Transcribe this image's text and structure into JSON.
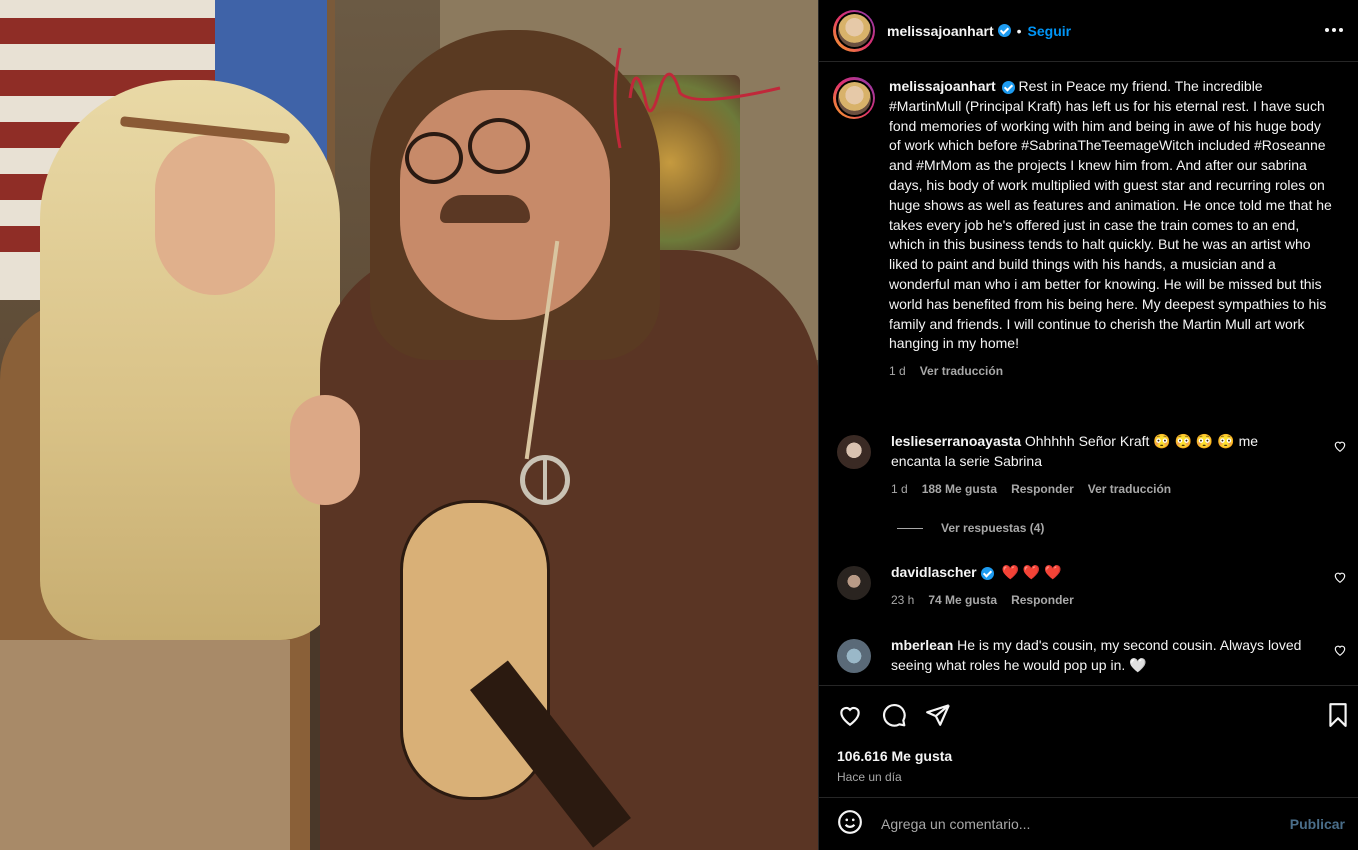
{
  "post": {
    "author": "melissajoanhart",
    "follow_label": "Seguir",
    "separator": "•",
    "caption": "Rest in Peace my friend. The incredible #MartinMull (Principal Kraft) has left us for his eternal rest. I have such fond memories of working with him and being in awe of his huge body of work which before #SabrinaTheTeemageWitch included #Roseanne and #MrMom as the projects I knew him from. And after our sabrina days, his body of work multiplied with guest star and recurring roles on huge shows as well as features and animation. He once told me that he takes every job he's offered just in case the train comes to an end, which in this business tends to halt quickly. But he was an artist who liked to paint and build things with his hands, a musician and a wonderful man who i am better for knowing. He will be missed but this world has benefited from his being here. My deepest sympathies to his family and friends. I will continue to cherish the Martin Mull art work hanging in my home!",
    "caption_time": "1 d",
    "see_translation": "Ver traducción",
    "likes": "106.616 Me gusta",
    "posted_ago": "Hace un día"
  },
  "comments": [
    {
      "user": "leslieserranoayasta",
      "text": "Ohhhhh Señor Kraft 😳 😳 😳 😳  me encanta la serie Sabrina",
      "time": "1 d",
      "likes": "188 Me gusta",
      "reply": "Responder",
      "translate": "Ver traducción",
      "view_replies": "Ver respuestas (4)"
    },
    {
      "user": "davidlascher",
      "text": "❤️ ❤️ ❤️",
      "time": "23 h",
      "likes": "74 Me gusta",
      "reply": "Responder"
    },
    {
      "user": "mberlean",
      "text": "He is my dad's cousin, my second cousin. Always loved seeing what roles he would pop up in. 🤍"
    }
  ],
  "composer": {
    "placeholder": "Agrega un comentario...",
    "publish_label": "Publicar"
  },
  "icons": {
    "header_more": "more-horizontal-icon",
    "like": "heart-icon",
    "comment": "comment-icon",
    "share": "send-icon",
    "save": "bookmark-icon",
    "emoji": "emoji-icon",
    "verified": "verified-badge-icon"
  },
  "colors": {
    "background": "#000000",
    "text": "#f5f5f5",
    "secondary_text": "#a8a8a8",
    "link": "#0095f6",
    "verified": "#1d9bf0",
    "divider": "#262626"
  }
}
